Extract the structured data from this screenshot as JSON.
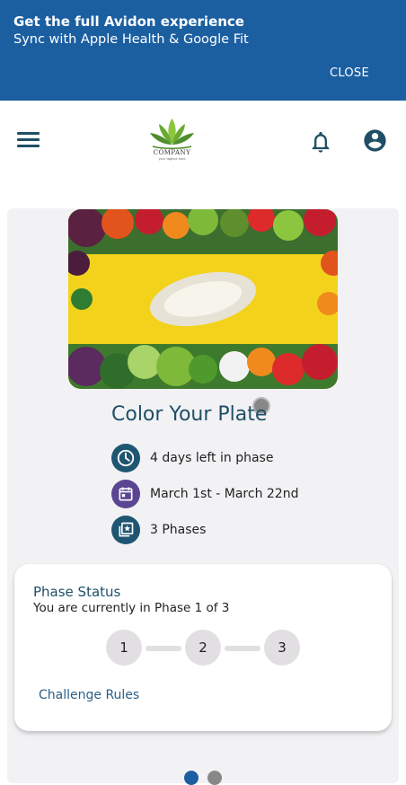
{
  "banner": {
    "title": "Get the full Avidon experience",
    "subtitle": "Sync with Apple Health & Google Fit",
    "close_label": "CLOSE"
  },
  "header": {
    "logo_text": "COMPANY",
    "logo_tagline": "your tagline here"
  },
  "challenge": {
    "title": "Color Your Plate",
    "days_left": "4 days left in phase",
    "date_range": "March 1st - March 22nd",
    "phases_count": "3 Phases"
  },
  "phase_status": {
    "title": "Phase Status",
    "subtitle": "You are currently in Phase 1 of 3",
    "phases": [
      "1",
      "2",
      "3"
    ],
    "rules_link": "Challenge Rules"
  },
  "colors": {
    "banner": "#1b5fa1",
    "primary_text": "#1e4f66",
    "icon_teal": "#1e5672",
    "icon_purple": "#5a4592",
    "dot_active": "#1b5fa1",
    "dot_inactive": "#888888"
  },
  "icons": {
    "menu": "hamburger-menu-icon",
    "notifications": "bell-icon",
    "account": "account-circle-icon",
    "days": "clock-icon",
    "dates": "calendar-icon",
    "phases": "phases-icon"
  }
}
